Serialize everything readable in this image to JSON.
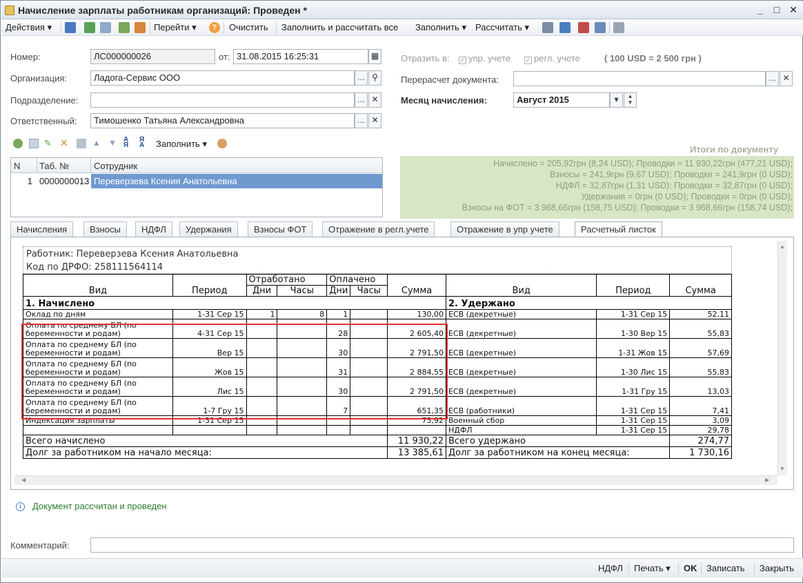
{
  "window": {
    "title": "Начисление зарплаты работникам организаций: Проведен *",
    "minimize": "_",
    "maximize": "□",
    "close": "✕"
  },
  "toolbar": {
    "actions": "Действия",
    "goto": "Перейти",
    "clear": "Очистить",
    "fill_calc_all": "Заполнить и рассчитать все",
    "fill": "Заполнить",
    "calculate": "Рассчитать",
    "help": "?"
  },
  "form": {
    "number_label": "Номер:",
    "number_value": "ЛС000000026",
    "date_label": "от:",
    "date_value": "31.08.2015 16:25:31",
    "org_label": "Организация:",
    "org_value": "Ладога-Сервис ООО",
    "dept_label": "Подразделение:",
    "dept_value": "",
    "resp_label": "Ответственный:",
    "resp_value": "Тимошенко Татьяна Александровна",
    "reflect_label": "Отразить в:",
    "reflect_mgmt": "упр. учете",
    "reflect_reg": "регл. учете",
    "currency_rate": "( 100 USD = 2 500 грн )",
    "recalc_label": "Перерасчет документа:",
    "recalc_value": "",
    "month_label": "Месяц начисления:",
    "month_value": "Август 2015"
  },
  "grid": {
    "fill_label": "Заполнить",
    "columns": [
      "N",
      "Таб. №",
      "Сотрудник"
    ],
    "rows": [
      {
        "n": "1",
        "tab": "0000000013",
        "employee": "Переверзева Ксения Анатольевна"
      }
    ]
  },
  "totals": {
    "title": "Итоги по документу",
    "lines": [
      "Начислено = 205,92грн (8,24 USD);   Проводки = 11 930,22грн (477,21 USD);",
      "Взносы = 241,9грн (9,67 USD);   Проводки = 241,9грн (0 USD);",
      "НДФЛ = 32,87грн (1,31 USD);   Проводки = 32,87грн (0 USD);",
      "Удержания = 0грн (0 USD);   Проводки = 0грн (0 USD);",
      "Взносы на ФОТ = 3 968,66грн (158,75 USD);   Проводки = 3 968,66грн (158,74 USD);"
    ]
  },
  "tabs": [
    "Начисления",
    "Взносы",
    "НДФЛ",
    "Удержания",
    "Взносы ФОТ",
    "Отражение в регл.учете",
    "Отражение в упр учете",
    "Расчетный листок"
  ],
  "payslip": {
    "worker": "Работник: Переверзева Ксения Анатольевна",
    "drfo": "Код по ДРФО: 258111564114",
    "h_vid": "Вид",
    "h_period": "Период",
    "h_worked": "Отработано",
    "h_paid": "Оплачено",
    "h_days": "Дни",
    "h_hours": "Часы",
    "h_sum": "Сумма",
    "h_vid2": "Вид",
    "h_period2": "Период",
    "h_sum2": "Сумма",
    "sec1": "1. Начислено",
    "sec2": "2. Удержано",
    "rows": [
      {
        "vid": "Оклад по дням",
        "period": "1-31 Сер 15",
        "wd": "1",
        "wh": "8",
        "pd": "1",
        "ph": "",
        "sum": "130,00",
        "vid2": "ЕСВ (декретные)",
        "period2": "1-31 Сер 15",
        "sum2": "52,11"
      },
      {
        "vid": "Оплата по среднему БЛ (по\nбеременности и родам)",
        "period": "4-31 Сер 15",
        "wd": "",
        "wh": "",
        "pd": "28",
        "ph": "",
        "sum": "2 605,40",
        "vid2": "ЕСВ (декретные)",
        "period2": "1-30 Вер 15",
        "sum2": "55,83"
      },
      {
        "vid": "Оплата по среднему БЛ (по\nбеременности и родам)",
        "period": "Вер 15",
        "wd": "",
        "wh": "",
        "pd": "30",
        "ph": "",
        "sum": "2 791,50",
        "vid2": "ЕСВ (декретные)",
        "period2": "1-31 Жов 15",
        "sum2": "57,69"
      },
      {
        "vid": "Оплата по среднему БЛ (по\nбеременности и родам)",
        "period": "Жов 15",
        "wd": "",
        "wh": "",
        "pd": "31",
        "ph": "",
        "sum": "2 884,55",
        "vid2": "ЕСВ (декретные)",
        "period2": "1-30 Лис 15",
        "sum2": "55,83"
      },
      {
        "vid": "Оплата по среднему БЛ (по\nбеременности и родам)",
        "period": "Лис 15",
        "wd": "",
        "wh": "",
        "pd": "30",
        "ph": "",
        "sum": "2 791,50",
        "vid2": "ЕСВ (декретные)",
        "period2": "1-31 Гру 15",
        "sum2": "13,03"
      },
      {
        "vid": "Оплата по среднему БЛ (по\nбеременности и родам)",
        "period": "1-7 Гру 15",
        "wd": "",
        "wh": "",
        "pd": "7",
        "ph": "",
        "sum": "651,35",
        "vid2": "ЕСВ (работники)",
        "period2": "1-31 Сер 15",
        "sum2": "7,41"
      },
      {
        "vid": "Индексация зарплаты",
        "period": "1-31 Сер 15",
        "wd": "",
        "wh": "",
        "pd": "",
        "ph": "",
        "sum": "75,92",
        "vid2": "Военный сбор",
        "period2": "1-31 Сер 15",
        "sum2": "3,09"
      },
      {
        "vid": "",
        "period": "",
        "wd": "",
        "wh": "",
        "pd": "",
        "ph": "",
        "sum": "",
        "vid2": "НДФЛ",
        "period2": "1-31 Сер 15",
        "sum2": "29,78"
      }
    ],
    "total_accrued_label": "Всего начислено",
    "total_accrued": "11 930,22",
    "total_withheld_label": "Всего удержано",
    "total_withheld": "274,77",
    "debt_start_label": "Долг за работником на начало месяца:",
    "debt_start": "13 385,61",
    "debt_end_label": "Долг за работником на конец месяца:",
    "debt_end": "1 730,16"
  },
  "status": {
    "message": "Документ рассчитан и проведен"
  },
  "comment": {
    "label": "Комментарий:",
    "value": ""
  },
  "bottom": {
    "ndfl": "НДФЛ",
    "print": "Печать",
    "ok": "OK",
    "save": "Записать",
    "close": "Закрыть"
  }
}
